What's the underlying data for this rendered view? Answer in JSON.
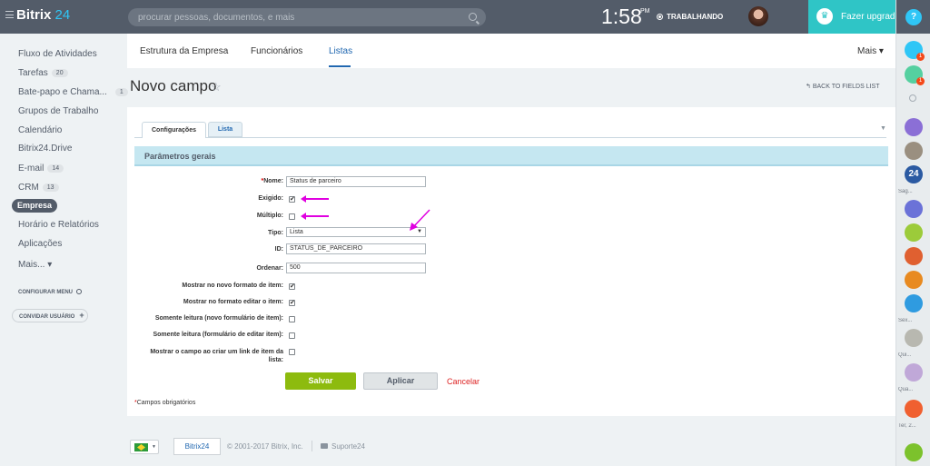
{
  "topbar": {
    "logo_text": "Bitrix",
    "logo_num": "24",
    "search_placeholder": "procurar pessoas, documentos, e mais",
    "clock": "1:58",
    "ampm": "PM",
    "work_status": "TRABALHANDO",
    "upgrade_label": "Fazer upgrade"
  },
  "sidebar": {
    "items": [
      {
        "label": "Fluxo de Atividades"
      },
      {
        "label": "Tarefas",
        "count": "20"
      },
      {
        "label": "Bate-papo e Chama...",
        "count": "1"
      },
      {
        "label": "Grupos de Trabalho"
      },
      {
        "label": "Calendário"
      },
      {
        "label": "Bitrix24.Drive"
      },
      {
        "label": "E-mail",
        "count": "14"
      },
      {
        "label": "CRM",
        "count": "13"
      },
      {
        "label": "Empresa"
      },
      {
        "label": "Horário e Relatórios"
      },
      {
        "label": "Aplicações"
      },
      {
        "label": "Mais..."
      }
    ],
    "configure_menu": "CONFIGURAR MENU",
    "invite_users": "CONVIDAR USUÁRIO"
  },
  "header": {
    "tabs": [
      "Estrutura da Empresa",
      "Funcionários",
      "Listas"
    ],
    "more": "Mais"
  },
  "page": {
    "title": "Novo campo",
    "back_link": "BACK TO FIELDS LIST"
  },
  "form": {
    "tabs": [
      "Configurações",
      "Lista"
    ],
    "section_title": "Parâmetros gerais",
    "fields": {
      "name_label": "Nome:",
      "name_value": "Status de parceiro",
      "required_label": "Exigido:",
      "multiple_label": "Múltiplo:",
      "type_label": "Tipo:",
      "type_value": "Lista",
      "id_label": "ID:",
      "id_value": "STATUS_DE_PARCEIRO",
      "sort_label": "Ordenar:",
      "sort_value": "500",
      "show_new_label": "Mostrar no novo formato de item:",
      "show_edit_label": "Mostrar no formato editar o item:",
      "readonly_new_label": "Somente leitura (novo formulário de item):",
      "readonly_edit_label": "Somente leitura (formulário de editar item):",
      "show_link_label_1": "Mostrar o campo ao criar um link de item da",
      "show_link_label_2": "lista:"
    },
    "checkboxes": {
      "required": true,
      "multiple": false,
      "show_new": true,
      "show_edit": true,
      "readonly_new": false,
      "readonly_edit": false,
      "show_link": false
    },
    "save_label": "Salvar",
    "apply_label": "Aplicar",
    "cancel_label": "Cancelar",
    "required_note": "Campos obrigatórios"
  },
  "footer": {
    "logo": "Bitrix24",
    "copyright": "© 2001-2017 Bitrix, Inc.",
    "support": "Suporte24"
  },
  "right_strip": {
    "labels": [
      "Sag...",
      "Sex...",
      "Qui...",
      "Qua...",
      "Ter, 2..."
    ],
    "badges": [
      "1",
      "1"
    ]
  },
  "colors": {
    "topbar": "#535c69",
    "accent": "#2fc6f6",
    "upgrade": "#2fc5c6",
    "link": "#2067b0",
    "save": "#8dbb0e",
    "annotation": "#e000e0"
  },
  "icons": [
    "hamburger-icon",
    "search-icon",
    "crown-icon",
    "help-icon",
    "bell-icon",
    "gear-icon",
    "star-icon",
    "arrow-back-icon",
    "flag-brazil-icon",
    "chat-icon",
    "phone-icon"
  ]
}
